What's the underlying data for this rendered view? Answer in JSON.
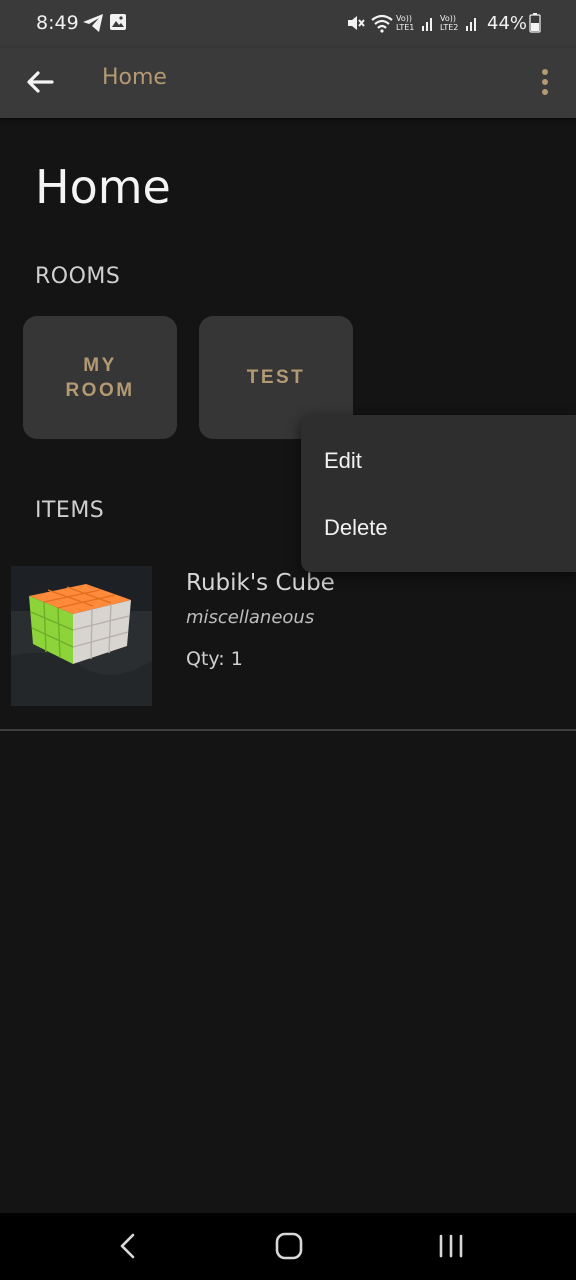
{
  "status_bar": {
    "time": "8:49",
    "battery": "44%",
    "signal_1_label": "Vo))\nLTE1",
    "signal_2_label": "Vo))\nLTE2",
    "icons": [
      "telegram-icon",
      "gallery-icon",
      "mute-icon",
      "wifi-icon",
      "signal-icon",
      "battery-icon"
    ]
  },
  "app_bar": {
    "title": "Home",
    "back_icon": "arrow-back-icon",
    "menu_icon": "more-vert-icon"
  },
  "page": {
    "title": "Home",
    "rooms_label": "ROOMS",
    "items_label": "ITEMS"
  },
  "rooms": [
    {
      "label": "MY ROOM"
    },
    {
      "label": "TEST"
    }
  ],
  "items": [
    {
      "name": "Rubik's Cube",
      "category": "miscellaneous",
      "qty": "Qty: 1"
    }
  ],
  "context_menu": {
    "items": [
      {
        "label": "Edit"
      },
      {
        "label": "Delete"
      }
    ]
  },
  "colors": {
    "accent": "#b39a73",
    "background": "#141414",
    "app_bar": "#3a3a3a",
    "card": "#363636",
    "menu": "#2e2e2e"
  }
}
